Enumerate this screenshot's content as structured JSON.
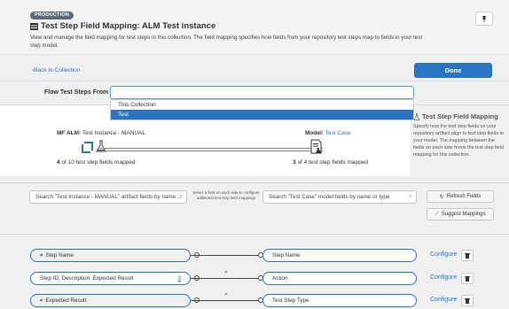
{
  "header": {
    "env_badge": "PRODUCTION",
    "title": "Test Step Field Mapping: ALM Test instance",
    "description": "View and manage the field mapping for test steps in this collection. The field mapping specifies how fields from your repository test steps map to fields in your test step model."
  },
  "nav": {
    "back_label": "Back to Collection",
    "done_label": "Done"
  },
  "flow": {
    "label": "Flow Test Steps From",
    "selected_value": "",
    "options": [
      "This Collection",
      "Test"
    ],
    "highlighted_option": "Test"
  },
  "mapping": {
    "source_prefix": "MF ALM:",
    "source_name": "Test Instance - MANUAL",
    "model_prefix": "Model:",
    "model_name": "Test Case",
    "source_mapped": "4",
    "source_count_text": "of 10 test step fields mapped",
    "model_mapped": "3",
    "model_count_text": "of 4 test step fields mapped"
  },
  "help": {
    "title": "Test Step Field Mapping",
    "body": "Specify how the test step fields on your repository artifact align to test step fields in your model. The mapping between the fields on each side forms the test step field mapping for this collection."
  },
  "search": {
    "source_placeholder": "Search \"Test Instance - MANUAL\" artifact fields by name ...",
    "hint": "Select a field on each side to configure additional test step field mappings",
    "model_placeholder": "Search \"Test Case\" model fields by name or type",
    "refresh_label": "Refresh Fields",
    "suggest_label": "Suggest Mappings"
  },
  "rows": [
    {
      "source": "Step Name",
      "source_count": "",
      "target": "Step Name",
      "configure": "Configure"
    },
    {
      "source": "Step ID; Description; Expected Result",
      "source_count": "3",
      "target": "Action",
      "configure": "Configure"
    },
    {
      "source": "Expected Result",
      "source_count": "",
      "target": "Test Step Type",
      "configure": "Configure"
    }
  ],
  "colors": {
    "accent": "#2a74c4",
    "badge": "#5b6b7b"
  }
}
